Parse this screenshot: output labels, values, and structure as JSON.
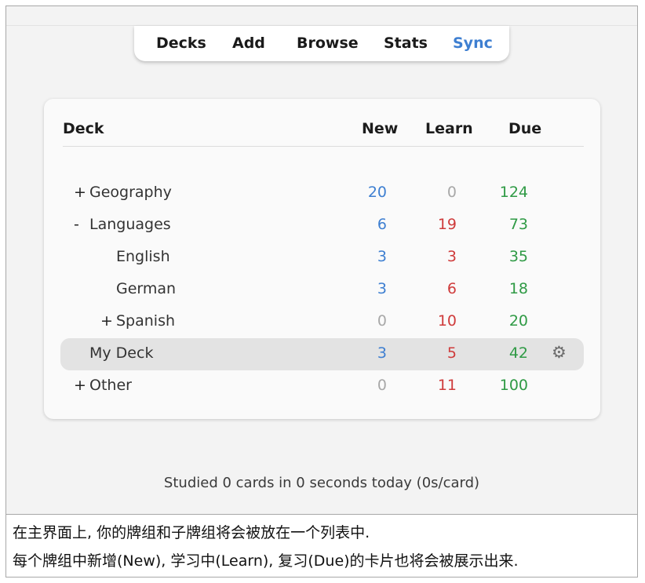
{
  "nav": {
    "decks": "Decks",
    "add": "Add",
    "browse": "Browse",
    "stats": "Stats",
    "sync": "Sync"
  },
  "table": {
    "headers": {
      "deck": "Deck",
      "new": "New",
      "learn": "Learn",
      "due": "Due"
    },
    "rows": [
      {
        "expander": "+",
        "name": "Geography",
        "new": "20",
        "learn": "0",
        "due": "124"
      },
      {
        "expander": "-",
        "name": "Languages",
        "new": "6",
        "learn": "19",
        "due": "73"
      },
      {
        "expander": "",
        "name": "English",
        "new": "3",
        "learn": "3",
        "due": "35"
      },
      {
        "expander": "",
        "name": "German",
        "new": "3",
        "learn": "6",
        "due": "18"
      },
      {
        "expander": "+",
        "name": "Spanish",
        "new": "0",
        "learn": "10",
        "due": "20"
      },
      {
        "expander": "",
        "name": "My Deck",
        "new": "3",
        "learn": "5",
        "due": "42",
        "current": true
      },
      {
        "expander": "+",
        "name": "Other",
        "new": "0",
        "learn": "11",
        "due": "100"
      }
    ],
    "options_icon": "gear-icon"
  },
  "footer": {
    "studied": "Studied 0 cards in 0 seconds today (0s/card)"
  },
  "caption": {
    "line1": "在主界面上, 你的牌组和子牌组将会被放在一个列表中.",
    "line2": "每个牌组中新增(New), 学习中(Learn), 复习(Due)的卡片也将会被展示出来."
  },
  "colors": {
    "new": "#3e7fd1",
    "learn": "#cf3b3b",
    "due": "#2f9a45",
    "zero": "#a8a8a8",
    "sync": "#3e7fd1"
  }
}
